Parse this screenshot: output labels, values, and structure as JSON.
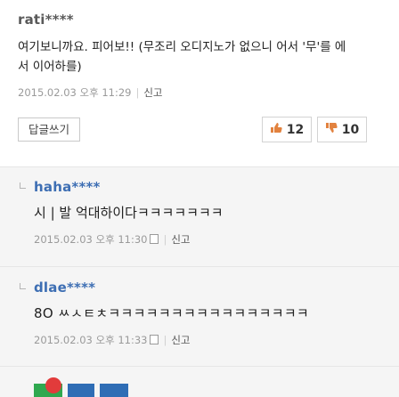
{
  "main_comment": {
    "author": "rati****",
    "text_line1": "여기보니까요. 피어보!! (무조리 오디지노가 없으니 어서 '무'를 에",
    "text_line2": "서 이어하를)",
    "date": "2015.02.03 오후 11:29",
    "report_label": "신고",
    "write_reply_label": "답글쓰기",
    "likes": "12",
    "dislikes": "10"
  },
  "replies": [
    {
      "author": "haha****",
      "text": "시 | 발 억대하이다ㅋㅋㅋㅋㅋㅋㅋ",
      "date": "2015.02.03 오후 11:30",
      "report_label": "신고"
    },
    {
      "author": "dlae****",
      "text": "8O ㅆㅅㅌㅊㅋㅋㅋㅋㅋㅋㅋㅋㅋㅋㅋㅋㅋㅋㅋㅋ",
      "date": "2015.02.03 오후 11:33",
      "report_label": "신고"
    }
  ],
  "colors": {
    "reply_author": "#3d6eb3",
    "like_icon": "#e2823f",
    "dislike_icon": "#e2823f",
    "meta_text": "#9a9a9a",
    "icon_green": "#2fa84f",
    "icon_blue": "#2f6db5"
  }
}
